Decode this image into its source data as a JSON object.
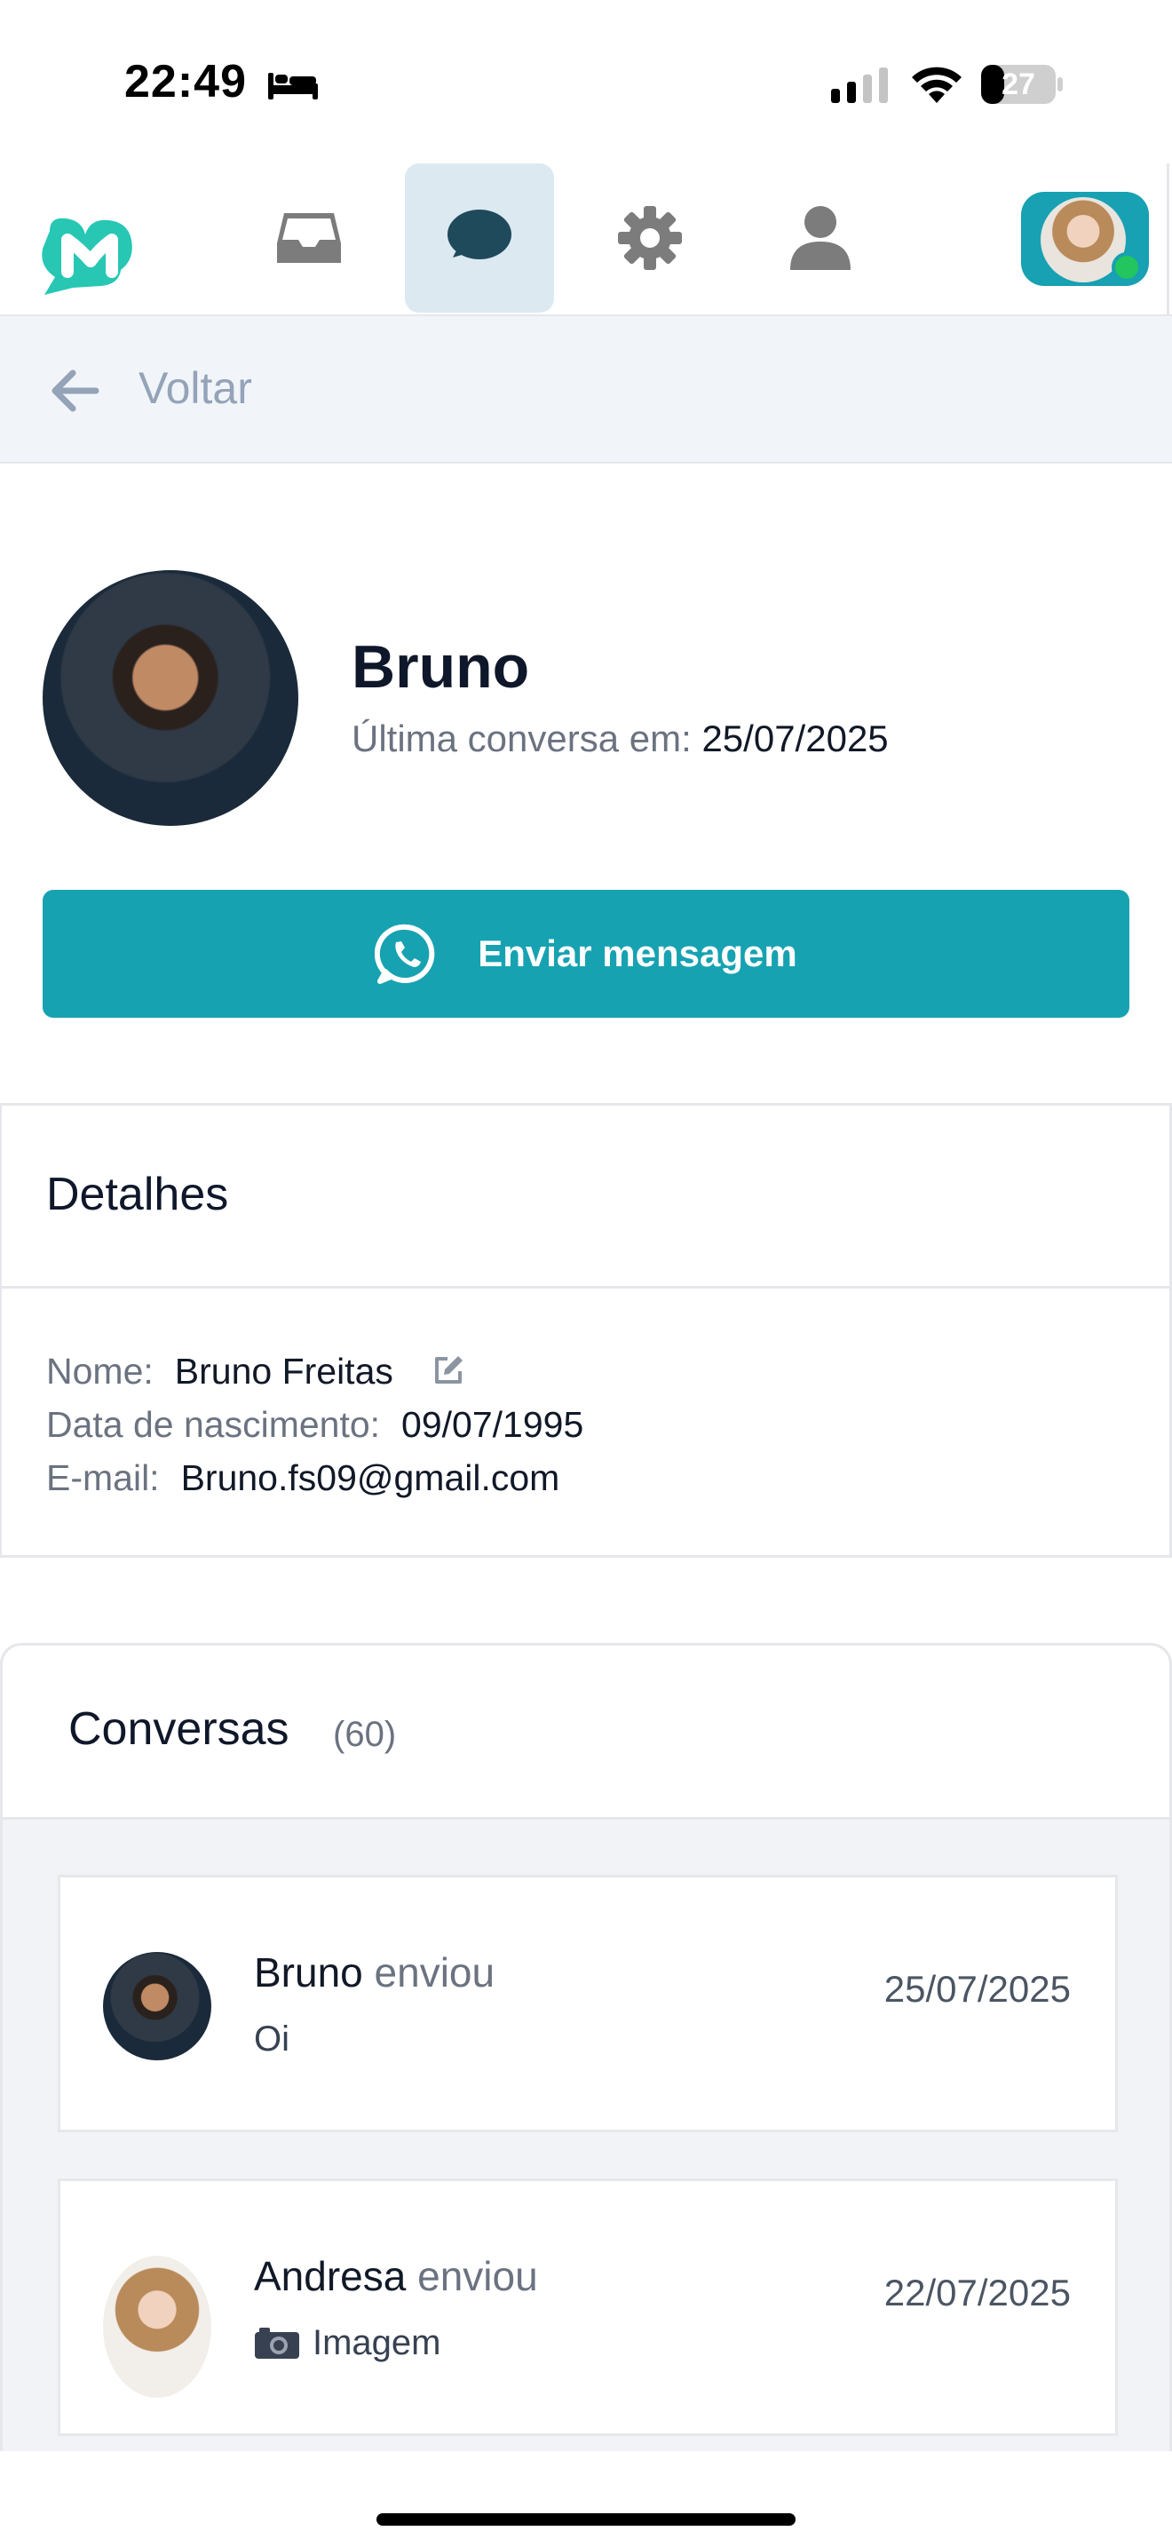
{
  "status_bar": {
    "time": "22:49",
    "battery": "27"
  },
  "nav": {
    "items": [
      {
        "icon": "inbox-icon"
      },
      {
        "icon": "chat-icon",
        "active": true
      },
      {
        "icon": "gear-icon"
      },
      {
        "icon": "user-icon"
      }
    ],
    "online_color": "#22c55e"
  },
  "back": {
    "label": "Voltar"
  },
  "profile": {
    "name": "Bruno",
    "last_conversation_label": "Última conversa em:",
    "last_conversation_date": "25/07/2025",
    "send_button_label": "Enviar mensagem"
  },
  "details": {
    "title": "Detalhes",
    "name_label": "Nome:",
    "name_value": "Bruno Freitas",
    "birth_label": "Data de nascimento:",
    "birth_value": "09/07/1995",
    "email_label": "E-mail:",
    "email_value": "Bruno.fs09@gmail.com"
  },
  "conversations": {
    "title": "Conversas",
    "count": "(60)",
    "items": [
      {
        "sender": "Bruno",
        "verb": "enviou",
        "preview": "Oi",
        "date": "25/07/2025"
      },
      {
        "sender": "Andresa",
        "verb": "enviou",
        "preview": "Imagem",
        "date": "22/07/2025",
        "icon": "camera-icon"
      }
    ]
  },
  "colors": {
    "accent": "#17a2b2",
    "nav_active_bg": "#dce9f1"
  }
}
